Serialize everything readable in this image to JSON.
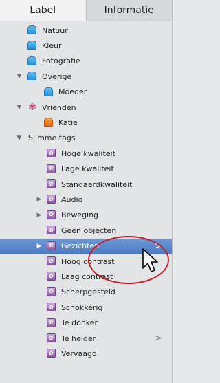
{
  "tabs": {
    "label": "Label",
    "info": "Informatie"
  },
  "tree": [
    {
      "id": "natuur",
      "label": "Natuur",
      "icon": "folder-blue",
      "indent": 0,
      "arrow": ""
    },
    {
      "id": "kleur",
      "label": "Kleur",
      "icon": "folder-blue",
      "indent": 0,
      "arrow": ""
    },
    {
      "id": "fotografie",
      "label": "Fotografie",
      "icon": "folder-blue",
      "indent": 0,
      "arrow": ""
    },
    {
      "id": "overige",
      "label": "Overige",
      "icon": "folder-blue",
      "indent": 0,
      "arrow": "down"
    },
    {
      "id": "moeder",
      "label": "Moeder",
      "icon": "folder-blue",
      "indent": 1,
      "arrow": ""
    },
    {
      "id": "vrienden",
      "label": "Vrienden",
      "icon": "flower",
      "indent": 0,
      "arrow": "down"
    },
    {
      "id": "katie",
      "label": "Katie",
      "icon": "folder-orange",
      "indent": 1,
      "arrow": ""
    },
    {
      "id": "slimme-tags",
      "label": "Slimme tags",
      "icon": "none",
      "indent": 0,
      "arrow": "down"
    },
    {
      "id": "hoge-kwaliteit",
      "label": "Hoge kwaliteit",
      "icon": "tag",
      "indent": 2,
      "arrow": ""
    },
    {
      "id": "lage-kwaliteit",
      "label": "Lage kwaliteit",
      "icon": "tag",
      "indent": 2,
      "arrow": ""
    },
    {
      "id": "standaardkwaliteit",
      "label": "Standaardkwaliteit",
      "icon": "tag",
      "indent": 2,
      "arrow": ""
    },
    {
      "id": "audio",
      "label": "Audio",
      "icon": "tag",
      "indent": 2,
      "arrow": "right"
    },
    {
      "id": "beweging",
      "label": "Beweging",
      "icon": "tag",
      "indent": 2,
      "arrow": "right"
    },
    {
      "id": "geen-objecten",
      "label": "Geen objecten",
      "icon": "tag",
      "indent": 2,
      "arrow": ""
    },
    {
      "id": "gezichten",
      "label": "Gezichten",
      "icon": "tag",
      "indent": 2,
      "arrow": "right",
      "selected": true,
      "chevron": true
    },
    {
      "id": "hoog-contrast",
      "label": "Hoog contrast",
      "icon": "tag",
      "indent": 2,
      "arrow": ""
    },
    {
      "id": "laag-contrast",
      "label": "Laag contrast",
      "icon": "tag",
      "indent": 2,
      "arrow": ""
    },
    {
      "id": "scherpgesteld",
      "label": "Scherpgesteld",
      "icon": "tag",
      "indent": 2,
      "arrow": ""
    },
    {
      "id": "schokkerig",
      "label": "Schokkerig",
      "icon": "tag",
      "indent": 2,
      "arrow": ""
    },
    {
      "id": "te-donker",
      "label": "Te donker",
      "icon": "tag",
      "indent": 2,
      "arrow": ""
    },
    {
      "id": "te-helder",
      "label": "Te helder",
      "icon": "tag",
      "indent": 2,
      "arrow": "",
      "chevron": true
    },
    {
      "id": "vervaagd",
      "label": "Vervaagd",
      "icon": "tag",
      "indent": 2,
      "arrow": ""
    }
  ],
  "chevron_glyph": ">",
  "tag_glyph": "✿",
  "flower_glyph": "✾",
  "colors": {
    "selected": "#5b86cc",
    "annotation": "#c81e2a"
  }
}
